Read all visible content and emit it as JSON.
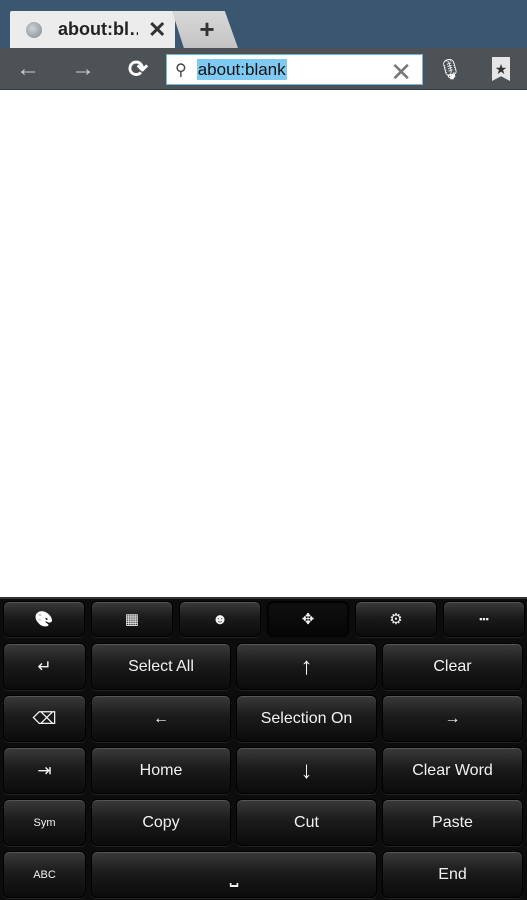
{
  "browser": {
    "tab": {
      "title": "about:bl…",
      "close": "✕"
    },
    "new_tab": "+",
    "toolbar": {
      "back": "←",
      "forward": "→",
      "reload": "⟳",
      "mic": "🎙",
      "bookmark": "★"
    },
    "omnibox": {
      "search_icon": "⚲",
      "value": "about:blank",
      "clear": "✕"
    }
  },
  "keyboard": {
    "top_row": [
      {
        "name": "theme-palette-icon",
        "glyph": "🎨"
      },
      {
        "name": "numpad-icon",
        "glyph": "▦"
      },
      {
        "name": "emoji-icon",
        "glyph": "☻"
      },
      {
        "name": "cursor-move-icon",
        "glyph": "✥",
        "active": true
      },
      {
        "name": "settings-gears-icon",
        "glyph": "⚙"
      },
      {
        "name": "keypad-grid-icon",
        "glyph": "▪▪▪"
      }
    ],
    "rows": [
      [
        "↵",
        "Select All",
        "↑",
        "Clear"
      ],
      [
        "⌫",
        "←",
        "Selection On",
        "→"
      ],
      [
        "⇥",
        "Home",
        "↓",
        "Clear Word"
      ],
      [
        "Sym",
        "Copy",
        "Cut",
        "Paste"
      ],
      [
        "ABC",
        "⎵",
        "End"
      ]
    ]
  }
}
